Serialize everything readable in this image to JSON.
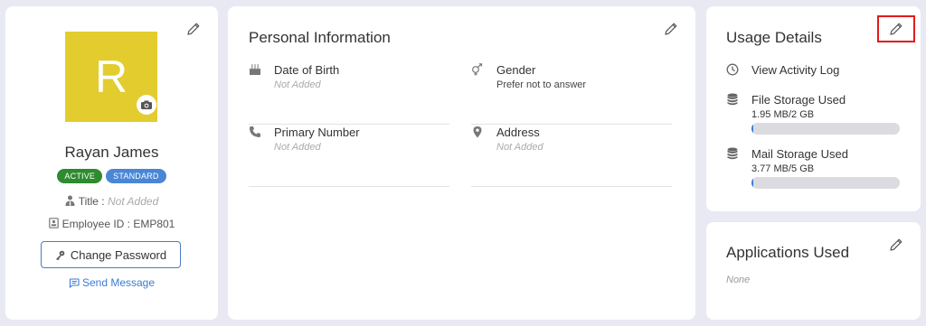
{
  "profile": {
    "avatar_letter": "R",
    "name": "Rayan James",
    "badges": [
      "ACTIVE",
      "STANDARD"
    ],
    "title_label": "Title : ",
    "title_value": "Not Added",
    "employee_id": "Employee ID : EMP801",
    "change_password": "Change Password",
    "send_message": "Send Message"
  },
  "personal": {
    "title": "Personal Information",
    "fields": [
      {
        "label": "Date of Birth",
        "value": "Not Added",
        "icon": "cake-icon"
      },
      {
        "label": "Gender",
        "value": "Prefer not to answer",
        "icon": "gender-icon"
      },
      {
        "label": "Primary Number",
        "value": "Not Added",
        "icon": "phone-icon"
      },
      {
        "label": "Address",
        "value": "Not Added",
        "icon": "location-pin-icon"
      }
    ]
  },
  "usage": {
    "title": "Usage Details",
    "activity_log": "View Activity Log",
    "file_storage": {
      "label": "File Storage Used",
      "value": "1.95 MB/2 GB",
      "fraction": 0.001
    },
    "mail_storage": {
      "label": "Mail Storage Used",
      "value": "3.77 MB/5 GB",
      "fraction": 0.001
    }
  },
  "apps": {
    "title": "Applications Used",
    "value": "None"
  },
  "colors": {
    "accent": "#3a7bd5",
    "avatar_bg": "#e3cc2e",
    "active_badge": "#2e8b2e",
    "standard_badge": "#4a86d6",
    "highlight": "#e21b1b"
  }
}
